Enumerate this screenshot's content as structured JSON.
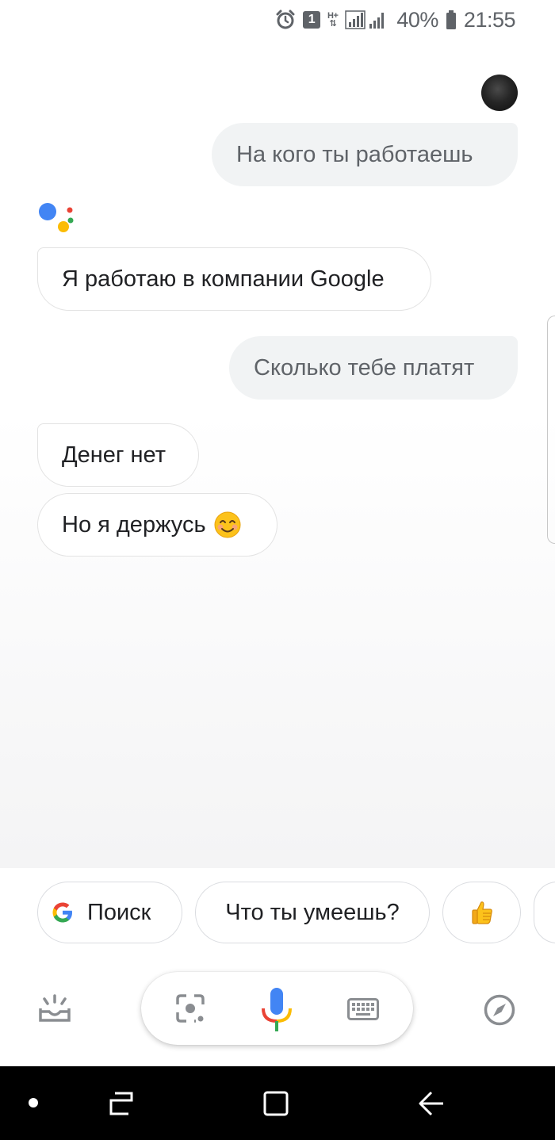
{
  "status_bar": {
    "notification_count": "1",
    "network_type": "H+",
    "battery_percent": "40%",
    "time": "21:55"
  },
  "conversation": {
    "user_messages": [
      "На кого ты работаешь",
      "Сколько тебе платят"
    ],
    "assistant_messages": [
      "Я работаю в компании Google",
      "Денег нет",
      "Но я держусь"
    ],
    "emoji": "😊"
  },
  "suggestions": {
    "search_label": "Поиск",
    "what_can_you_do_label": "Что ты умеешь?",
    "thumbs_up": "👍"
  },
  "colors": {
    "google_blue": "#4285F4",
    "google_red": "#EA4335",
    "google_yellow": "#FBBC05",
    "google_green": "#34A853",
    "icon_gray": "#8a8d91"
  },
  "icons": {
    "status": [
      "alarm-icon",
      "signal-icon",
      "battery-icon"
    ],
    "bottom": [
      "updates-icon",
      "lens-icon",
      "mic-icon",
      "keyboard-icon",
      "explore-icon"
    ],
    "nav": [
      "dot-icon",
      "recents-icon",
      "home-icon",
      "back-icon"
    ]
  }
}
